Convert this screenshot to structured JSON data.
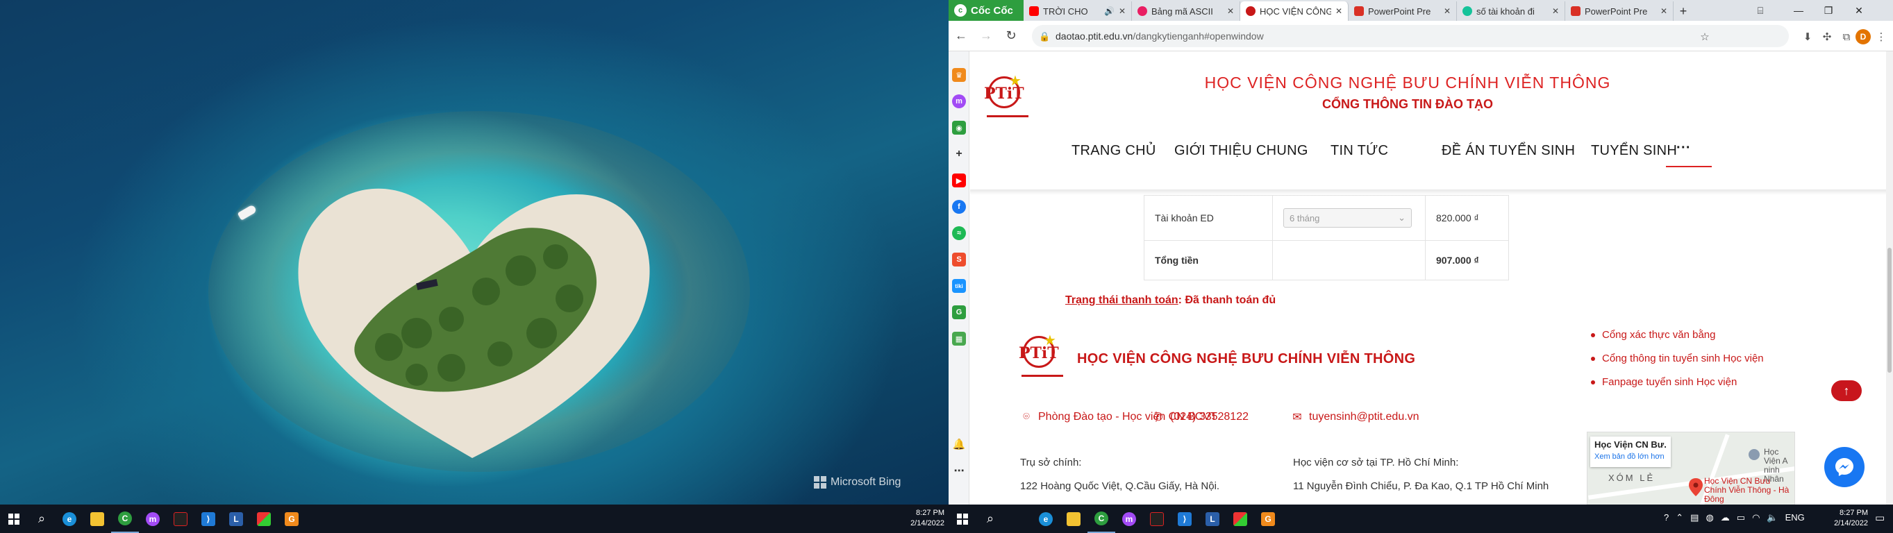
{
  "left_screen": {
    "watermark": "Microsoft Bing",
    "taskbar": {
      "clock_time": "8:27 PM",
      "clock_date": "2/14/2022"
    }
  },
  "browser": {
    "brand": "Cốc Cốc",
    "tabs": [
      {
        "title": "TRỜI CHO",
        "favicon": "youtube-icon",
        "color": "#ff0000",
        "active": false,
        "audio": true
      },
      {
        "title": "Bảng mã ASCII",
        "favicon": "heart-icon",
        "color": "#e91e63",
        "active": false
      },
      {
        "title": "HỌC VIỆN CÔNG",
        "favicon": "ptit-icon",
        "color": "#c81818",
        "active": true
      },
      {
        "title": "PowerPoint Pre",
        "favicon": "pdf-icon",
        "color": "#d93025",
        "active": false
      },
      {
        "title": "số tài khoản đi",
        "favicon": "grammarly-icon",
        "color": "#15c39a",
        "active": false
      },
      {
        "title": "PowerPoint Pre",
        "favicon": "pdf-icon",
        "color": "#d93025",
        "active": false
      }
    ],
    "address": {
      "host": "daotao.ptit.edu.vn",
      "path": "/dangkytienganh#openwindow"
    },
    "profile_initial": "D"
  },
  "site": {
    "title_line1": "HỌC VIỆN CÔNG NGHỆ BƯU CHÍNH VIỄN THÔNG",
    "title_line2": "CỔNG THÔNG TIN ĐÀO TẠO",
    "logo_text": "PTiT",
    "nav": [
      {
        "label": "TRANG CHỦ"
      },
      {
        "label": "GIỚI THIỆU CHUNG"
      },
      {
        "label": "TIN TỨC"
      },
      {
        "label": "ĐỀ ÁN TUYỂN SINH"
      },
      {
        "label": "TUYỂN SINH"
      },
      {
        "label": "···"
      }
    ],
    "payment_table": {
      "rows": [
        {
          "label": "Tài khoản ED",
          "select_value": "6 tháng",
          "amount": "820.000 ₫"
        },
        {
          "label": "Tổng tiền",
          "select_value": "",
          "amount": "907.000 ₫"
        }
      ]
    },
    "payment_status_label": "Trạng thái thanh toán",
    "payment_status_value": ": Đã thanh toán đủ",
    "footer": {
      "org_name": "HỌC VIỆN CÔNG NGHỆ BƯU CHÍNH VIỄN THÔNG",
      "office": "Phòng Đào tạo - Học viện CN BCVT",
      "phone": "(024) 33528122",
      "email": "tuyensinh@ptit.edu.vn",
      "hq_heading": "Trụ sở chính:",
      "hq_address": "122 Hoàng Quốc Việt, Q.Cầu Giấy, Hà Nội.",
      "hcm_heading": "Học viện cơ sở tại TP. Hồ Chí Minh:",
      "hcm_address": "11 Nguyễn Đình Chiểu, P. Đa Kao, Q.1 TP Hồ Chí Minh",
      "links": [
        "Cổng xác thực văn bằng",
        "Cổng thông tin tuyển sinh Học viện",
        "Fanpage tuyển sinh Học viện"
      ],
      "map": {
        "place": "Học Viện CN Bư...",
        "view_larger": "Xem bản đồ lớn hơn",
        "pin_label": "Học Viện CN Bưu Chính Viễn Thông - Hà Đông",
        "district": "XÓM LẺ",
        "side_label": "Học Viện A ninh Nhân"
      }
    }
  },
  "right_taskbar": {
    "lang": "ENG",
    "clock_time": "8:27 PM",
    "clock_date": "2/14/2022"
  }
}
